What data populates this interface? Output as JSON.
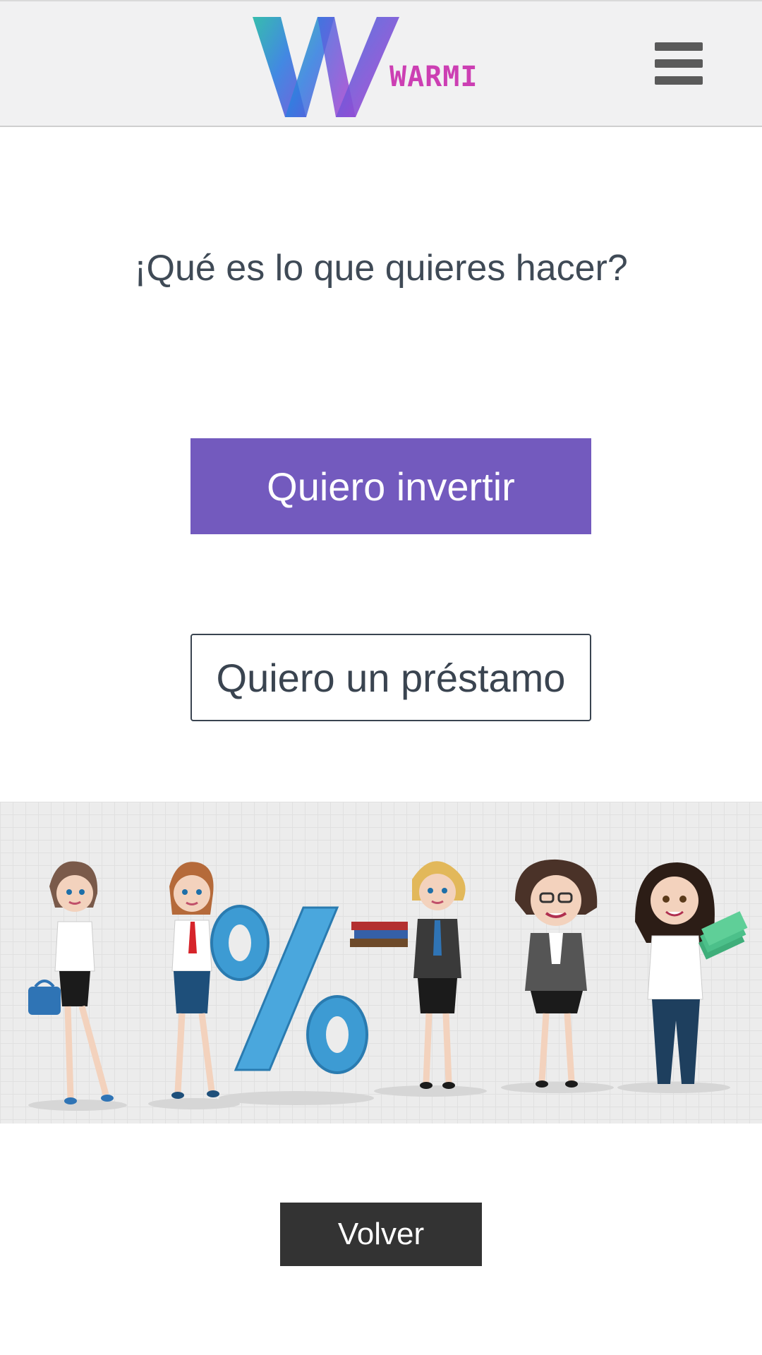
{
  "header": {
    "logo_text": "WARMI",
    "menu_icon": "hamburger-menu-icon"
  },
  "main": {
    "question": "¡Qué es lo que quieres hacer?",
    "invest_label": "Quiero invertir",
    "loan_label": "Quiero un préstamo",
    "back_label": "Volver"
  },
  "colors": {
    "header_bg": "#f1f1f2",
    "invest_button": "#735abe",
    "back_button": "#333333",
    "logo_text": "#cc3fb3",
    "text": "#3f4a56"
  },
  "banner": {
    "icons": [
      "businesswoman-handbag-icon",
      "businesswoman-tie-icon",
      "percent-sign-icon",
      "businesswoman-books-icon",
      "businesswoman-glasses-icon",
      "businesswoman-money-icon"
    ]
  }
}
